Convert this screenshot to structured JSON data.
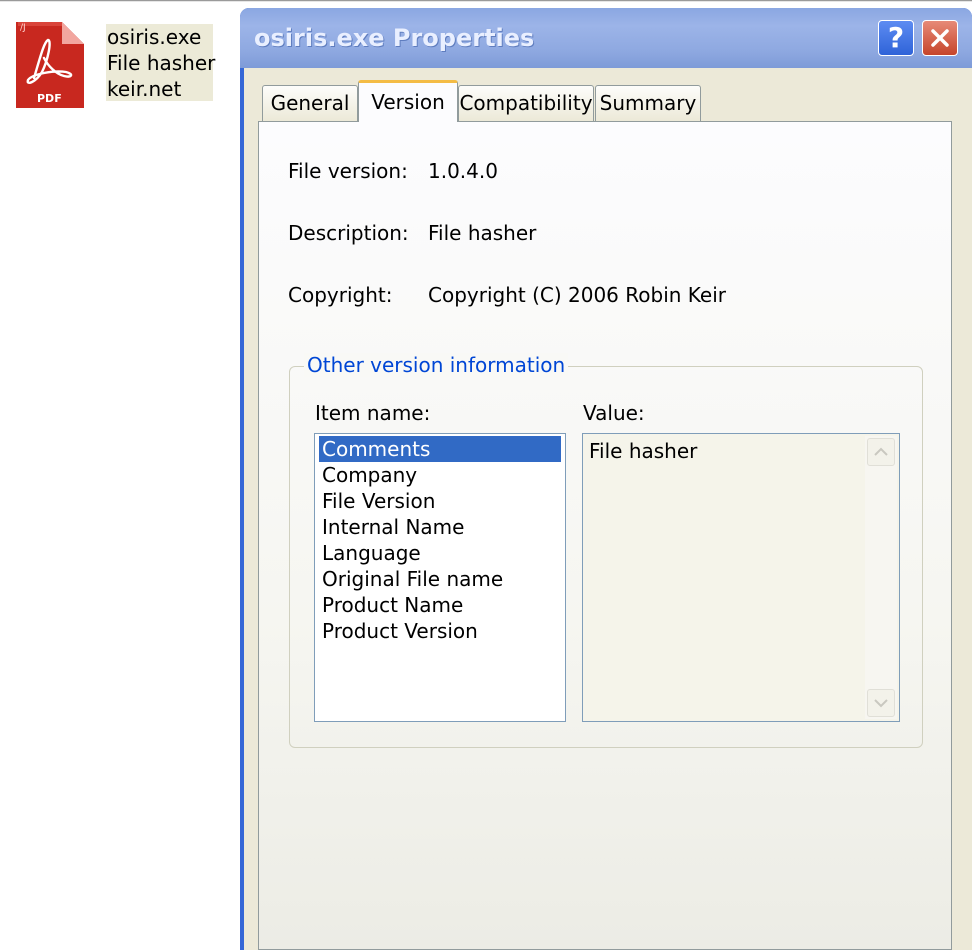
{
  "desktop": {
    "file_icon": "pdf-file-icon",
    "file_icon_badge": "PDF",
    "label_lines": [
      "osiris.exe",
      "File hasher",
      "keir.net"
    ]
  },
  "dialog": {
    "title": "osiris.exe Properties",
    "help_icon": "help-icon",
    "close_icon": "close-icon",
    "tabs": [
      {
        "label": "General"
      },
      {
        "label": "Version"
      },
      {
        "label": "Compatibility"
      },
      {
        "label": "Summary"
      }
    ],
    "active_tab": "Version",
    "fields": {
      "file_version_label": "File version:",
      "file_version_value": "1.0.4.0",
      "description_label": "Description:",
      "description_value": "File hasher",
      "copyright_label": "Copyright:",
      "copyright_value": "Copyright (C) 2006 Robin Keir"
    },
    "other_info": {
      "legend": "Other version information",
      "item_name_label": "Item name:",
      "value_label": "Value:",
      "items": [
        "Comments",
        "Company",
        "File Version",
        "Internal Name",
        "Language",
        "Original File name",
        "Product Name",
        "Product Version"
      ],
      "selected_item": "Comments",
      "value_text": "File hasher"
    }
  },
  "colors": {
    "title_text": "#e9efff",
    "selection": "#316ac5",
    "legend_text": "#0046d5",
    "active_tab_accent": "#f4bc45"
  }
}
